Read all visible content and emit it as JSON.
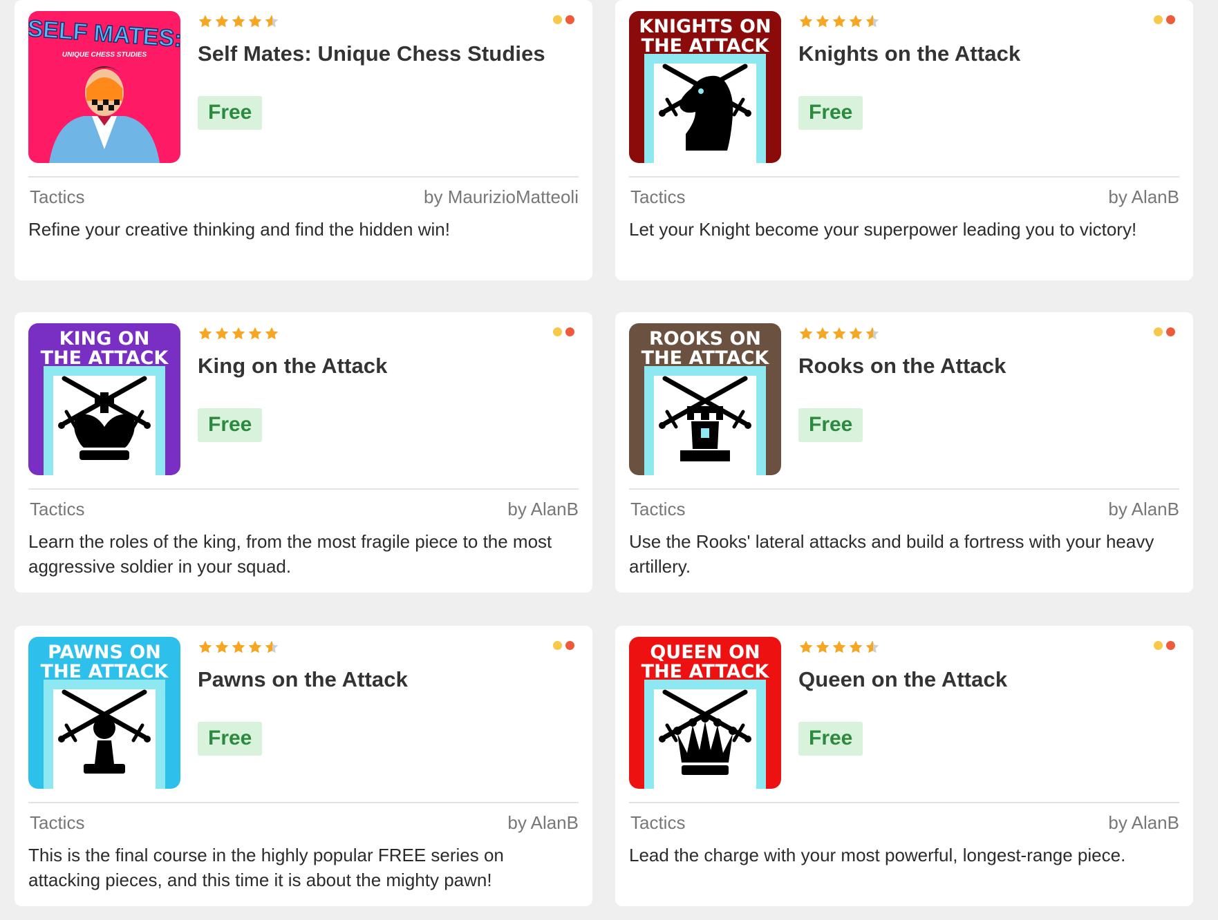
{
  "courses": [
    {
      "title": "Self Mates: Unique Chess Studies",
      "rating": 4.5,
      "price": "Free",
      "category": "Tactics",
      "author": "by MaurizioMatteoli",
      "description": "Refine your creative thinking and find the hidden win!",
      "cover": {
        "line1": "SELF MATES:",
        "line2": "UNIQUE CHESS STUDIES",
        "style": "selfmates",
        "bg": "#ff1a66"
      }
    },
    {
      "title": "Knights on the Attack",
      "rating": 4.5,
      "price": "Free",
      "category": "Tactics",
      "author": "by AlanB",
      "description": "Let your Knight become your superpower leading you to victory!",
      "cover": {
        "line1": "KNIGHTS ON",
        "line2": "THE ATTACK",
        "style": "knight",
        "bg": "#8b0b0b"
      }
    },
    {
      "title": "King on the Attack",
      "rating": 5,
      "price": "Free",
      "category": "Tactics",
      "author": "by AlanB",
      "description": "Learn the roles of the king, from the most fragile piece to the most aggressive soldier in your squad.",
      "cover": {
        "line1": "KING ON",
        "line2": "THE ATTACK",
        "style": "king",
        "bg": "#7a2fc4"
      }
    },
    {
      "title": "Rooks on the Attack",
      "rating": 4.5,
      "price": "Free",
      "category": "Tactics",
      "author": "by AlanB",
      "description": "Use the Rooks' lateral attacks and build a fortress with your heavy artillery.",
      "cover": {
        "line1": "ROOKS ON",
        "line2": "THE ATTACK",
        "style": "rook",
        "bg": "#6b5240"
      }
    },
    {
      "title": "Pawns on the Attack",
      "rating": 4.5,
      "price": "Free",
      "category": "Tactics",
      "author": "by AlanB",
      "description": "This is the final course in the highly popular FREE series on attacking pieces, and this time it is about the mighty pawn!",
      "cover": {
        "line1": "PAWNS ON",
        "line2": "THE ATTACK",
        "style": "pawn",
        "bg": "#2cc0ea"
      }
    },
    {
      "title": "Queen on the Attack",
      "rating": 4.5,
      "price": "Free",
      "category": "Tactics",
      "author": "by AlanB",
      "description": "Lead the charge with your most powerful, longest-range piece.",
      "cover": {
        "line1": "QUEEN ON",
        "line2": "THE ATTACK",
        "style": "queen",
        "bg": "#ee1111"
      }
    }
  ],
  "colors": {
    "star": "#f5a623",
    "star_empty": "#cfcfcf",
    "dot_yellow": "#f8c84a",
    "dot_red": "#ee5a3a",
    "price_bg": "#d8f2dc",
    "price_text": "#2b8a3e",
    "frame_cyan": "#8ee8f2"
  }
}
